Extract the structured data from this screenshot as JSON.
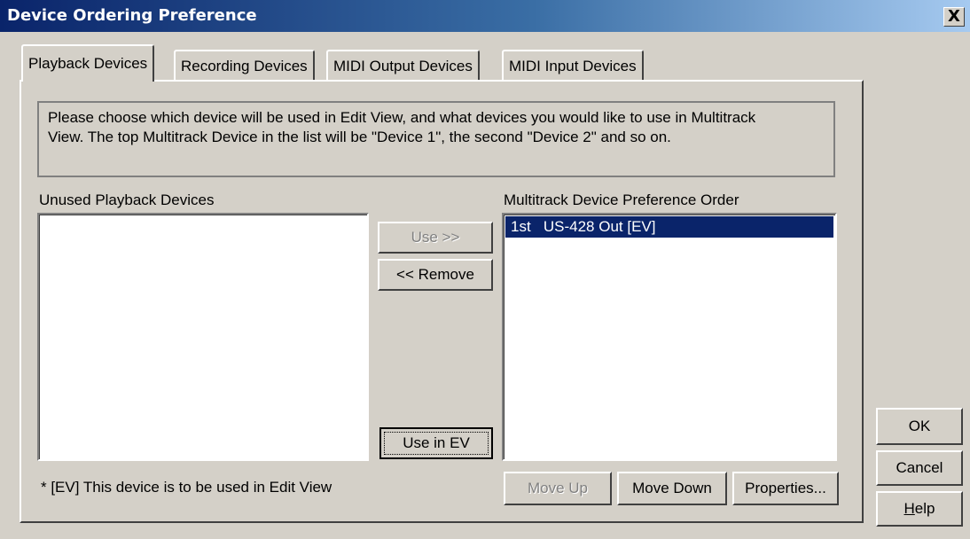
{
  "window": {
    "title": "Device Ordering Preference",
    "close_symbol": "X"
  },
  "tabs": [
    {
      "label": "Playback Devices",
      "active": true
    },
    {
      "label": "Recording Devices",
      "active": false
    },
    {
      "label": "MIDI Output Devices",
      "active": false
    },
    {
      "label": "MIDI Input Devices",
      "active": false
    }
  ],
  "info": {
    "line1": "Please choose which device will be used in Edit View, and what devices you would like to use in Multitrack",
    "line2": "View.  The top Multitrack Device in the list will be \"Device 1\", the second \"Device 2\" and so on."
  },
  "unused": {
    "label": "Unused Playback Devices",
    "items": []
  },
  "multitrack": {
    "label": "Multitrack Device Preference Order",
    "items": [
      {
        "order": "1st",
        "name": "US-428 Out [EV]",
        "selected": true
      }
    ]
  },
  "buttons": {
    "use": "Use >>",
    "remove": "<< Remove",
    "use_in_ev": "Use in EV",
    "move_up": "Move Up",
    "move_down": "Move Down",
    "properties": "Properties...",
    "ok": "OK",
    "cancel": "Cancel",
    "help_prefix": "H",
    "help_rest": "elp"
  },
  "footnote": "* [EV] This device is to be used in Edit View",
  "colors": {
    "face": "#d4d0c8",
    "selection": "#0a246a",
    "title_start": "#0a246a",
    "title_end": "#a6caf0"
  }
}
